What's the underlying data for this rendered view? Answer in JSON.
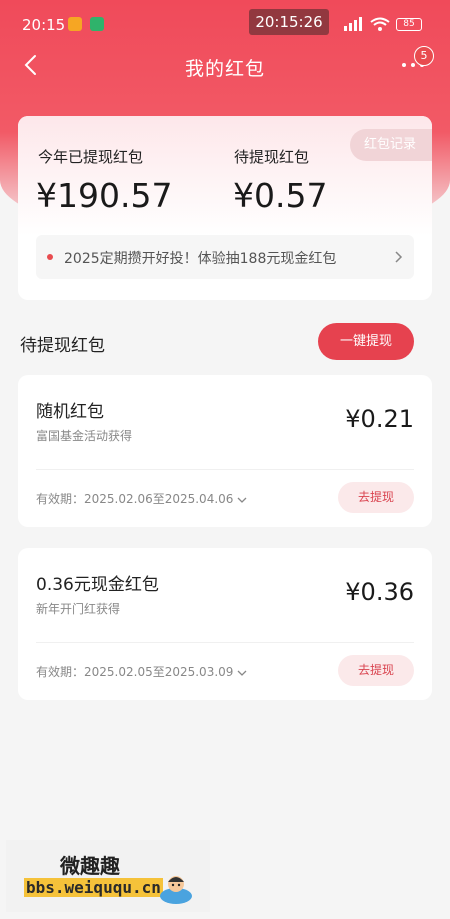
{
  "status_bar": {
    "time": "20:15",
    "overlay_time": "20:15:26",
    "battery": "85"
  },
  "nav": {
    "title": "我的红包",
    "more_badge": "5"
  },
  "summary": {
    "record_label": "红包记录",
    "withdrawn_label": "今年已提现红包",
    "withdrawn_amount": "¥190.57",
    "pending_label": "待提现红包",
    "pending_amount": "¥0.57",
    "promo_text": "2025定期攒开好投！体验抽188元现金红包"
  },
  "section": {
    "title": "待提现红包",
    "withdraw_all_label": "一键提现"
  },
  "envelopes": [
    {
      "name": "随机红包",
      "source": "富国基金活动获得",
      "amount": "¥0.21",
      "validity": "有效期：2025.02.06至2025.04.06",
      "action": "去提现"
    },
    {
      "name": "0.36元现金红包",
      "source": "新年开门红获得",
      "amount": "¥0.36",
      "validity": "有效期：2025.02.05至2025.03.09",
      "action": "去提现"
    }
  ],
  "watermark": {
    "line1": "微趣趣",
    "line2": "bbs.weiququ.cn"
  },
  "colors": {
    "brand_red": "#e6424f",
    "header_red": "#f04a5a",
    "background": "#f5f5f5"
  }
}
